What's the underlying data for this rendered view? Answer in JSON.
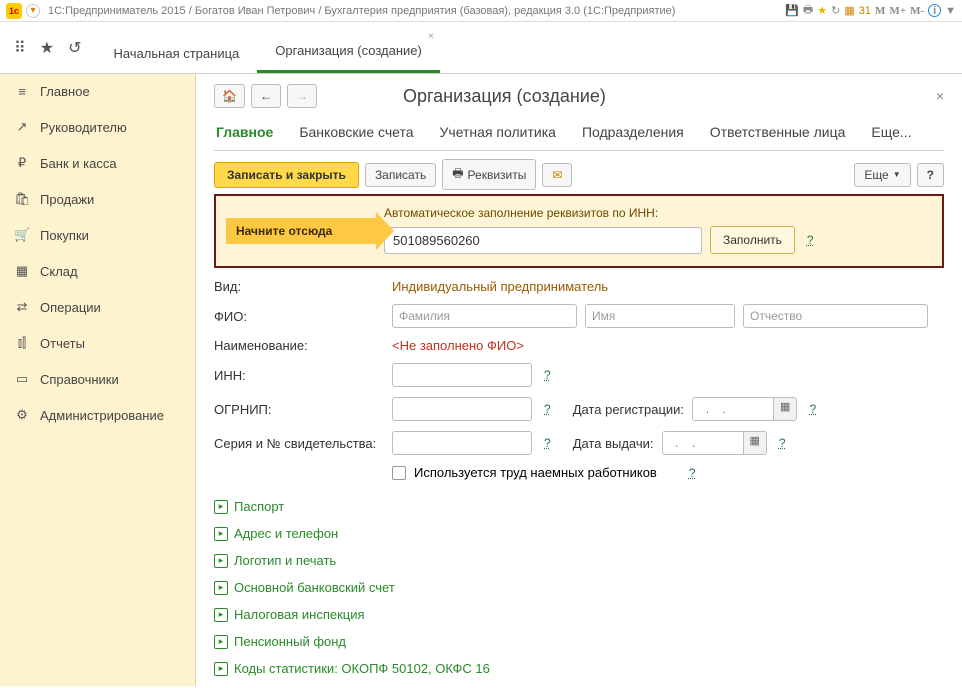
{
  "titlebar": {
    "title": "1С:Предприниматель 2015 / Богатов Иван Петрович / Бухгалтерия предприятия (базовая), редакция 3.0   (1С:Предприятие)",
    "m1": "M",
    "m2": "M+",
    "m3": "M-"
  },
  "tabs": {
    "home": "Начальная страница",
    "active": "Организация (создание)"
  },
  "sidebar": {
    "items": [
      {
        "label": "Главное",
        "icon": "≡"
      },
      {
        "label": "Руководителю",
        "icon": "↗"
      },
      {
        "label": "Банк и касса",
        "icon": "₽"
      },
      {
        "label": "Продажи",
        "icon": "🛍"
      },
      {
        "label": "Покупки",
        "icon": "🛒"
      },
      {
        "label": "Склад",
        "icon": "▦"
      },
      {
        "label": "Операции",
        "icon": "⇄"
      },
      {
        "label": "Отчеты",
        "icon": "⫾⫿"
      },
      {
        "label": "Справочники",
        "icon": "▭"
      },
      {
        "label": "Администрирование",
        "icon": "⚙"
      }
    ]
  },
  "page": {
    "title": "Организация (создание)",
    "subtabs": [
      "Главное",
      "Банковские счета",
      "Учетная политика",
      "Подразделения",
      "Ответственные лица",
      "Еще..."
    ],
    "saveClose": "Записать и закрыть",
    "save": "Записать",
    "reqs": "Реквизиты",
    "more": "Еще",
    "q": "?"
  },
  "inn": {
    "start": "Начните отсюда",
    "autoLabel": "Автоматическое заполнение реквизитов по ИНН:",
    "value": "501089560260",
    "fill": "Заполнить",
    "q": "?"
  },
  "form": {
    "vid_l": "Вид:",
    "vid_v": "Индивидуальный предприниматель",
    "fio_l": "ФИО:",
    "fam_ph": "Фамилия",
    "imya_ph": "Имя",
    "otch_ph": "Отчество",
    "name_l": "Наименование:",
    "name_v": "<Не заполнено ФИО>",
    "inn_l": "ИНН:",
    "q": "?",
    "ogrnip_l": "ОГРНИП:",
    "datereg_l": "Дата регистрации:",
    "dateph": "  .    .",
    "serial_l": "Серия и № свидетельства:",
    "dateiss_l": "Дата выдачи:",
    "hired_l": "Используется труд наемных работников"
  },
  "expands": [
    "Паспорт",
    "Адрес и телефон",
    "Логотип и печать",
    "Основной банковский счет",
    "Налоговая инспекция",
    "Пенсионный фонд",
    "Коды статистики: ОКОПФ 50102, ОКФС 16"
  ]
}
